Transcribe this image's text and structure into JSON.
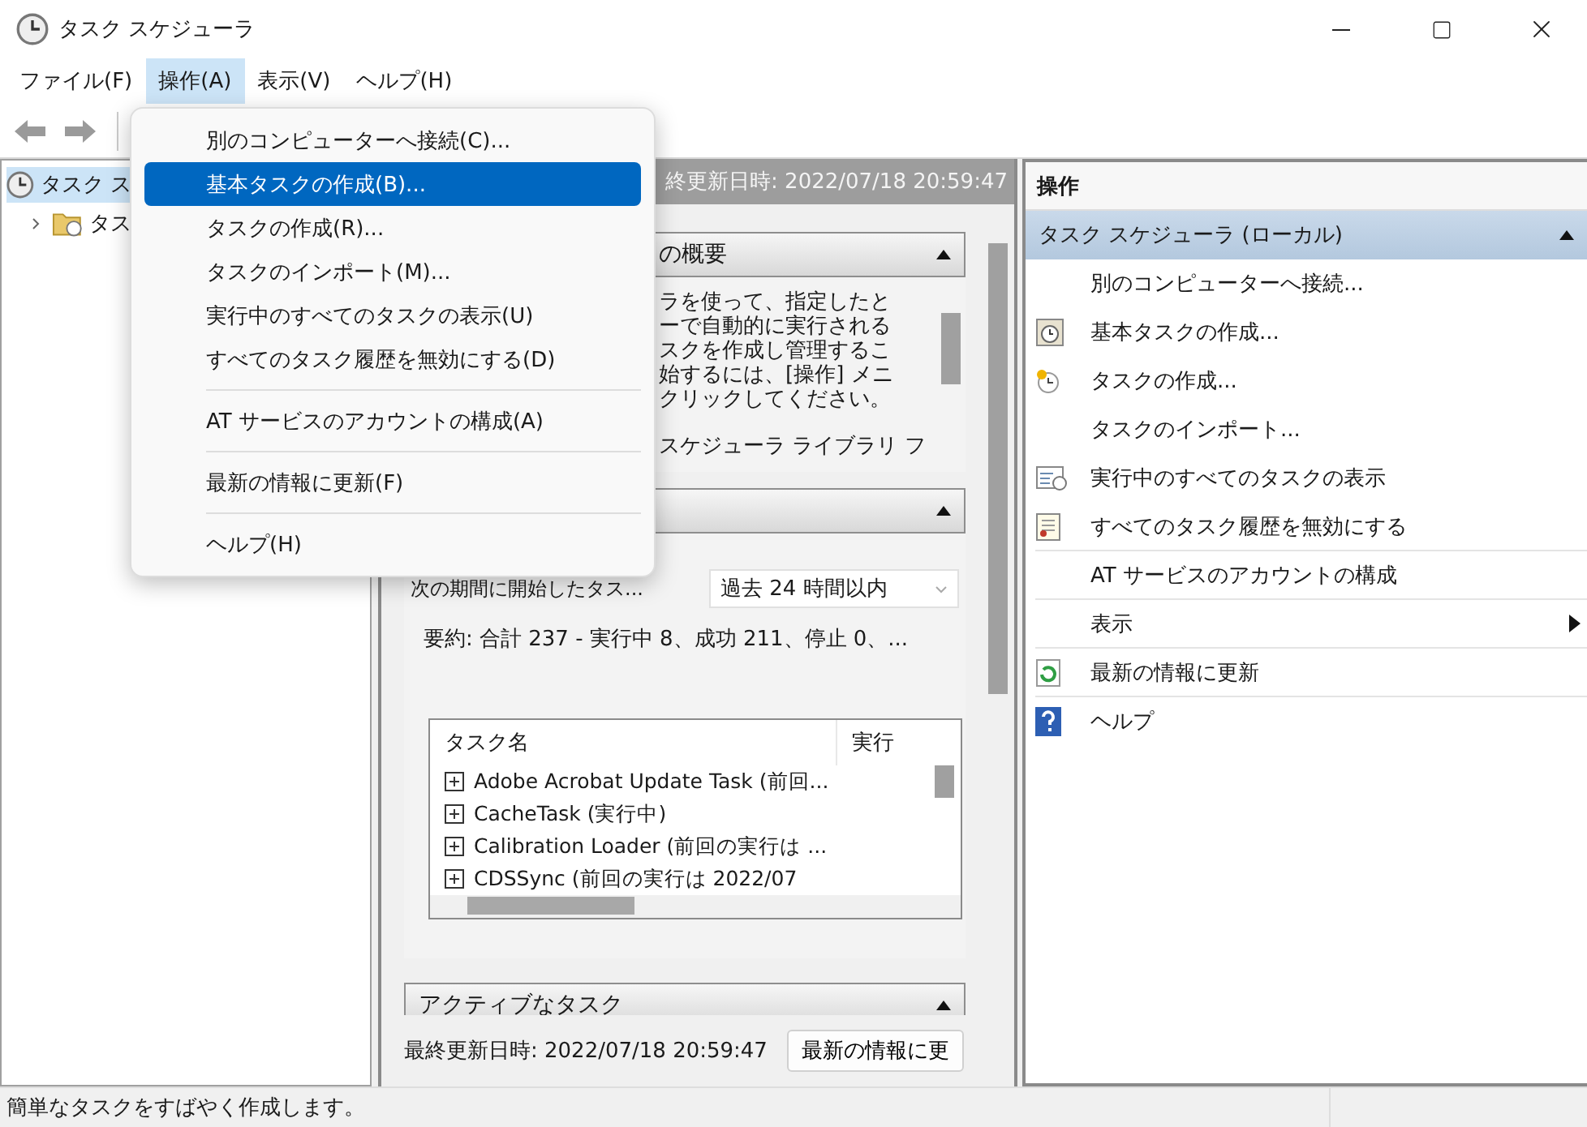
{
  "window": {
    "title": "タスク スケジューラ"
  },
  "menu_bar": [
    {
      "label": "ファイル(F)",
      "selected": false
    },
    {
      "label": "操作(A)",
      "selected": true
    },
    {
      "label": "表示(V)",
      "selected": false
    },
    {
      "label": "ヘルプ(H)",
      "selected": false
    }
  ],
  "dropdown_menu": {
    "items": [
      {
        "label": "別のコンピューターへ接続(C)...",
        "selected": false,
        "separator_after": false
      },
      {
        "label": "基本タスクの作成(B)...",
        "selected": true,
        "separator_after": false
      },
      {
        "label": "タスクの作成(R)...",
        "selected": false,
        "separator_after": false
      },
      {
        "label": "タスクのインポート(M)...",
        "selected": false,
        "separator_after": false
      },
      {
        "label": "実行中のすべてのタスクの表示(U)",
        "selected": false,
        "separator_after": false
      },
      {
        "label": "すべてのタスク履歴を無効にする(D)",
        "selected": false,
        "separator_after": true
      },
      {
        "label": "AT サービスのアカウントの構成(A)",
        "selected": false,
        "separator_after": true
      },
      {
        "label": "最新の情報に更新(F)",
        "selected": false,
        "separator_after": true
      },
      {
        "label": "ヘルプ(H)",
        "selected": false,
        "separator_after": false
      }
    ]
  },
  "tree": [
    {
      "label": "タスク ス",
      "selected": true,
      "children": [
        {
          "label": "タス",
          "selected": false,
          "expanded": false
        }
      ]
    }
  ],
  "center_pane": {
    "header": "終更新日時: 2022/07/18 20:59:47",
    "overview": {
      "title": "の概要",
      "text_lines": [
        "ラを使って、指定したと",
        "ーで自動的に実行される",
        "スクを作成し管理するこ",
        "始するには、[操作] メニ",
        "クリックしてください。"
      ],
      "library_line": "スケジューラ ライブラリ フ"
    },
    "status": {
      "period_label": "次の期間に開始したタス...",
      "period_value": "過去 24 時間以内",
      "summary": "要約: 合計 237 - 実行中 8、成功 211、停止 0、...",
      "table": {
        "columns": [
          "タスク名",
          "実行"
        ],
        "rows": [
          "Adobe Acrobat Update Task (前回...",
          "CacheTask (実行中)",
          "Calibration Loader (前回の実行は ...",
          "CDSSync (前回の実行は 2022/07"
        ]
      }
    },
    "active_title": "アクティブなタスク",
    "footer_text": "最終更新日時: 2022/07/18 20:59:47",
    "refresh_button": "最新の情報に更"
  },
  "actions_pane": {
    "title": "操作",
    "group": "タスク スケジューラ (ローカル)",
    "items": [
      {
        "label": "別のコンピューターへ接続...",
        "kind": "none",
        "submenu": false,
        "separator_after": false
      },
      {
        "label": "基本タスクの作成...",
        "kind": "calendar",
        "submenu": false,
        "separator_after": false
      },
      {
        "label": "タスクの作成...",
        "kind": "clock",
        "submenu": false,
        "separator_after": false
      },
      {
        "label": "タスクのインポート...",
        "kind": "none",
        "submenu": false,
        "separator_after": false
      },
      {
        "label": "実行中のすべてのタスクの表示",
        "kind": "list",
        "submenu": false,
        "separator_after": false
      },
      {
        "label": "すべてのタスク履歴を無効にする",
        "kind": "notepad",
        "submenu": false,
        "separator_after": true
      },
      {
        "label": "AT サービスのアカウントの構成",
        "kind": "none",
        "submenu": false,
        "separator_after": true
      },
      {
        "label": "表示",
        "kind": "none",
        "submenu": true,
        "separator_after": true
      },
      {
        "label": "最新の情報に更新",
        "kind": "refresh",
        "submenu": false,
        "separator_after": true
      },
      {
        "label": "ヘルプ",
        "kind": "help",
        "submenu": false,
        "separator_after": false
      }
    ]
  },
  "status_bar": {
    "text": "簡単なタスクをすばやく作成します。"
  }
}
